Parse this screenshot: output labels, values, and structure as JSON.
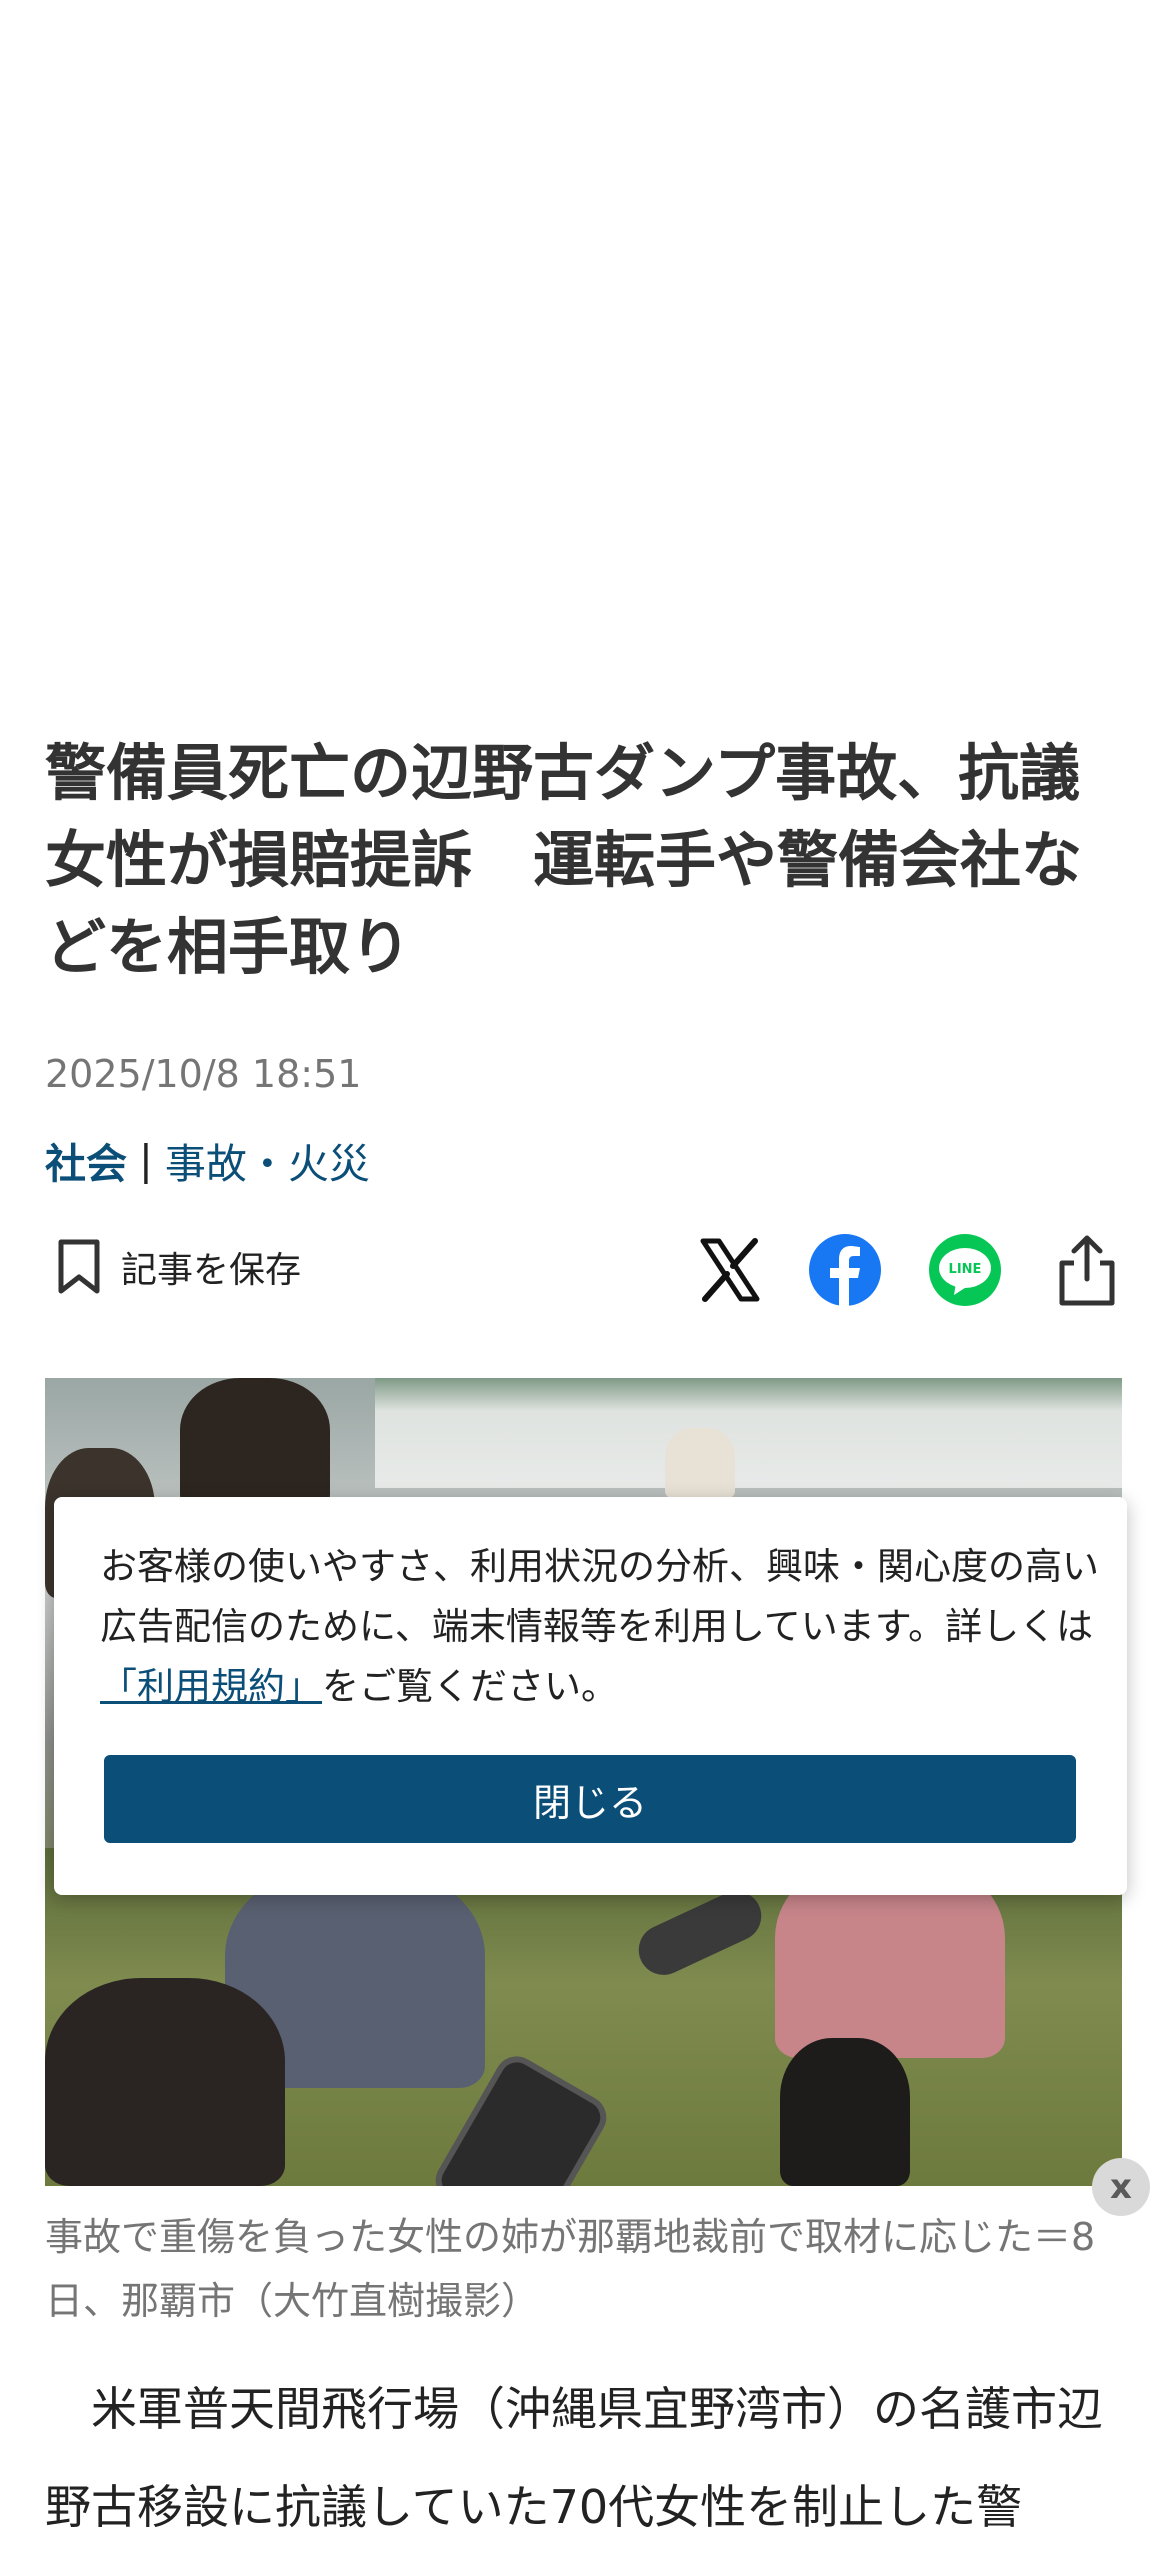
{
  "article": {
    "headline": "警備員死亡の辺野古ダンプ事故、抗議女性が損賠提訴　運転手や警備会社などを相手取り",
    "date": "2025/10/8 18:51",
    "category_primary": "社会",
    "category_separator": "|",
    "category_secondary": "事故・火災",
    "save_label": "記事を保存",
    "photo_caption": "事故で重傷を負った女性の姉が那覇地裁前で取材に応じた＝8日、那覇市（大竹直樹撮影）",
    "body_first_paragraph": "米軍普天間飛行場（沖縄県宜野湾市）の名護市辺野古移設に抗議していた70代女性を制止した警"
  },
  "share": {
    "icons": [
      "x-icon",
      "facebook-icon",
      "line-icon",
      "share-icon"
    ],
    "line_label": "LINE",
    "facebook_color": "#1877f2",
    "line_color": "#06c755"
  },
  "cookie_banner": {
    "text_before_link": "お客様の使いやすさ、利用状況の分析、興味・関心度の高い広告配信のために、端末情報等を利用しています。詳しくは",
    "link_text": "「利用規約」",
    "text_after_link": "をご覧ください。",
    "close_label": "閉じる"
  },
  "ad_close_label": "x",
  "colors": {
    "accent": "#0b4f79",
    "meta_gray": "#757575"
  }
}
